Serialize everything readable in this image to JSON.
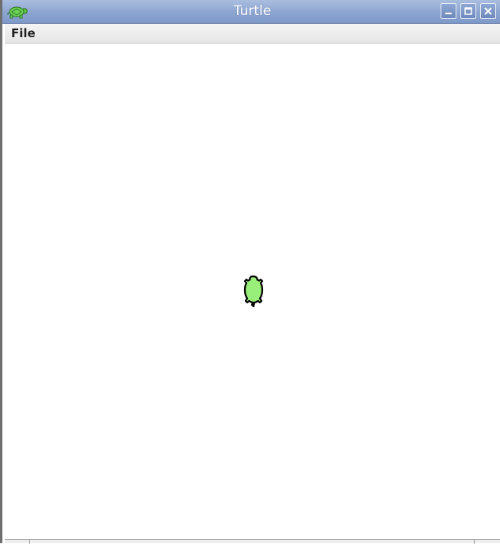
{
  "window": {
    "title": "Turtle",
    "app_icon": "turtle-icon",
    "controls": [
      "minimize-icon",
      "maximize-icon",
      "close-icon"
    ]
  },
  "menubar": {
    "items": [
      {
        "label": "File"
      }
    ]
  },
  "canvas": {
    "background": "#ffffff",
    "turtle": {
      "icon": "turtle-icon",
      "fill_color": "#98f07a",
      "outline_color": "#000000"
    }
  }
}
